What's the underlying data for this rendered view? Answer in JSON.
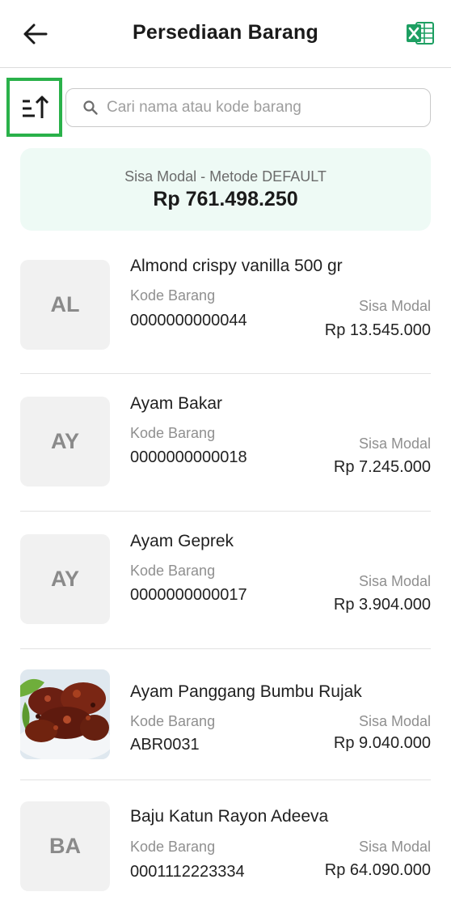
{
  "header": {
    "title": "Persediaan Barang",
    "back_icon": "arrow-left-icon",
    "export_icon": "excel-icon"
  },
  "toolbar": {
    "sort_icon": "sort-ascending-icon",
    "search_placeholder": "Cari nama atau kode barang",
    "search_value": ""
  },
  "summary": {
    "label": "Sisa Modal - Metode DEFAULT",
    "value": "Rp 761.498.250"
  },
  "colors": {
    "accent": "#2ab14a",
    "excel_green": "#1d9f62",
    "summary_bg": "#eefaf5"
  },
  "products": [
    {
      "initials": "AL",
      "name": "Almond crispy vanilla 500 gr",
      "code_label": "Kode Barang",
      "code": "0000000000044",
      "modal_label": "Sisa Modal",
      "modal": "Rp 13.545.000",
      "has_photo": false
    },
    {
      "initials": "AY",
      "name": "Ayam Bakar",
      "code_label": "Kode Barang",
      "code": "0000000000018",
      "modal_label": "Sisa Modal",
      "modal": "Rp 7.245.000",
      "has_photo": false
    },
    {
      "initials": "AY",
      "name": "Ayam Geprek",
      "code_label": "Kode Barang",
      "code": "0000000000017",
      "modal_label": "Sisa Modal",
      "modal": "Rp 3.904.000",
      "has_photo": false
    },
    {
      "initials": "",
      "name": "Ayam Panggang Bumbu Rujak",
      "code_label": "Kode Barang",
      "code": "ABR0031",
      "modal_label": "Sisa Modal",
      "modal": "Rp 9.040.000",
      "has_photo": true
    },
    {
      "initials": "BA",
      "name": "Baju Katun Rayon Adeeva",
      "code_label": "Kode Barang",
      "code": "0001112223334",
      "modal_label": "Sisa Modal",
      "modal": "Rp 64.090.000",
      "has_photo": false
    }
  ]
}
